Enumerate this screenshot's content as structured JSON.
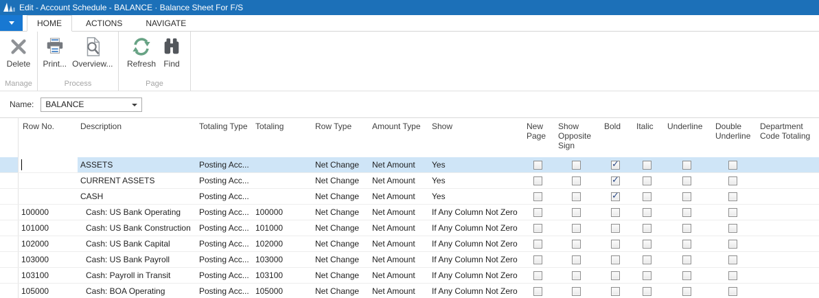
{
  "window": {
    "title": "Edit - Account Schedule - BALANCE · Balance Sheet For F/S"
  },
  "tabs": [
    {
      "label": "HOME",
      "selected": true
    },
    {
      "label": "ACTIONS",
      "selected": false
    },
    {
      "label": "NAVIGATE",
      "selected": false
    }
  ],
  "ribbon": {
    "groups": [
      {
        "label": "Manage",
        "buttons": [
          {
            "label": "Delete",
            "icon": "delete-x-icon"
          }
        ]
      },
      {
        "label": "Process",
        "buttons": [
          {
            "label": "Print...",
            "icon": "printer-icon"
          },
          {
            "label": "Overview...",
            "icon": "overview-page-magnifier-icon"
          }
        ]
      },
      {
        "label": "Page",
        "buttons": [
          {
            "label": "Refresh",
            "icon": "refresh-icon"
          },
          {
            "label": "Find",
            "icon": "binoculars-icon"
          }
        ]
      }
    ]
  },
  "filter": {
    "name_label": "Name:",
    "name_value": "BALANCE"
  },
  "table": {
    "columns": [
      "Row No.",
      "Description",
      "Totaling Type",
      "Totaling",
      "Row Type",
      "Amount Type",
      "Show",
      "New Page",
      "Show Opposite Sign",
      "Bold",
      "Italic",
      "Underline",
      "Double Underline",
      "Department Code Totaling"
    ],
    "rows": [
      {
        "row_no": "",
        "description": "ASSETS",
        "indent": 0,
        "totaling_type": "Posting Acc...",
        "totaling": "",
        "row_type": "Net Change",
        "amount_type": "Net Amount",
        "show": "Yes",
        "dept_code_totaling": "",
        "selected": true,
        "editing": true,
        "checks": {
          "new_page": false,
          "show_opposite_sign": false,
          "bold": true,
          "italic": false,
          "underline": false,
          "double_underline": false
        }
      },
      {
        "row_no": "",
        "description": "CURRENT ASSETS",
        "indent": 0,
        "totaling_type": "Posting Acc...",
        "totaling": "",
        "row_type": "Net Change",
        "amount_type": "Net Amount",
        "show": "Yes",
        "dept_code_totaling": "",
        "selected": false,
        "editing": false,
        "checks": {
          "new_page": false,
          "show_opposite_sign": false,
          "bold": true,
          "italic": false,
          "underline": false,
          "double_underline": false
        }
      },
      {
        "row_no": "",
        "description": "CASH",
        "indent": 0,
        "totaling_type": "Posting Acc...",
        "totaling": "",
        "row_type": "Net Change",
        "amount_type": "Net Amount",
        "show": "Yes",
        "dept_code_totaling": "",
        "selected": false,
        "editing": false,
        "checks": {
          "new_page": false,
          "show_opposite_sign": false,
          "bold": true,
          "italic": false,
          "underline": false,
          "double_underline": false
        }
      },
      {
        "row_no": "100000",
        "description": "Cash: US Bank Operating",
        "indent": 1,
        "totaling_type": "Posting Acc...",
        "totaling": "100000",
        "row_type": "Net Change",
        "amount_type": "Net Amount",
        "show": "If Any Column Not Zero",
        "dept_code_totaling": "",
        "selected": false,
        "editing": false,
        "checks": {
          "new_page": false,
          "show_opposite_sign": false,
          "bold": false,
          "italic": false,
          "underline": false,
          "double_underline": false
        }
      },
      {
        "row_no": "101000",
        "description": "Cash: US Bank Construction",
        "indent": 1,
        "totaling_type": "Posting Acc...",
        "totaling": "101000",
        "row_type": "Net Change",
        "amount_type": "Net Amount",
        "show": "If Any Column Not Zero",
        "dept_code_totaling": "",
        "selected": false,
        "editing": false,
        "checks": {
          "new_page": false,
          "show_opposite_sign": false,
          "bold": false,
          "italic": false,
          "underline": false,
          "double_underline": false
        }
      },
      {
        "row_no": "102000",
        "description": "Cash: US Bank Capital",
        "indent": 1,
        "totaling_type": "Posting Acc...",
        "totaling": "102000",
        "row_type": "Net Change",
        "amount_type": "Net Amount",
        "show": "If Any Column Not Zero",
        "dept_code_totaling": "",
        "selected": false,
        "editing": false,
        "checks": {
          "new_page": false,
          "show_opposite_sign": false,
          "bold": false,
          "italic": false,
          "underline": false,
          "double_underline": false
        }
      },
      {
        "row_no": "103000",
        "description": "Cash: US Bank Payroll",
        "indent": 1,
        "totaling_type": "Posting Acc...",
        "totaling": "103000",
        "row_type": "Net Change",
        "amount_type": "Net Amount",
        "show": "If Any Column Not Zero",
        "dept_code_totaling": "",
        "selected": false,
        "editing": false,
        "checks": {
          "new_page": false,
          "show_opposite_sign": false,
          "bold": false,
          "italic": false,
          "underline": false,
          "double_underline": false
        }
      },
      {
        "row_no": "103100",
        "description": "Cash: Payroll in Transit",
        "indent": 1,
        "totaling_type": "Posting Acc...",
        "totaling": "103100",
        "row_type": "Net Change",
        "amount_type": "Net Amount",
        "show": "If Any Column Not Zero",
        "dept_code_totaling": "",
        "selected": false,
        "editing": false,
        "checks": {
          "new_page": false,
          "show_opposite_sign": false,
          "bold": false,
          "italic": false,
          "underline": false,
          "double_underline": false
        }
      },
      {
        "row_no": "105000",
        "description": "Cash: BOA Operating",
        "indent": 1,
        "totaling_type": "Posting Acc...",
        "totaling": "105000",
        "row_type": "Net Change",
        "amount_type": "Net Amount",
        "show": "If Any Column Not Zero",
        "dept_code_totaling": "",
        "selected": false,
        "editing": false,
        "checks": {
          "new_page": false,
          "show_opposite_sign": false,
          "bold": false,
          "italic": false,
          "underline": false,
          "double_underline": false
        }
      }
    ]
  },
  "colors": {
    "titlebar_blue": "#1c70b8",
    "app_menu_blue": "#1878d2",
    "selection_blue": "#cfe5f7",
    "checkmark_navy": "#2c4a87",
    "refresh_green": "#68a385"
  }
}
